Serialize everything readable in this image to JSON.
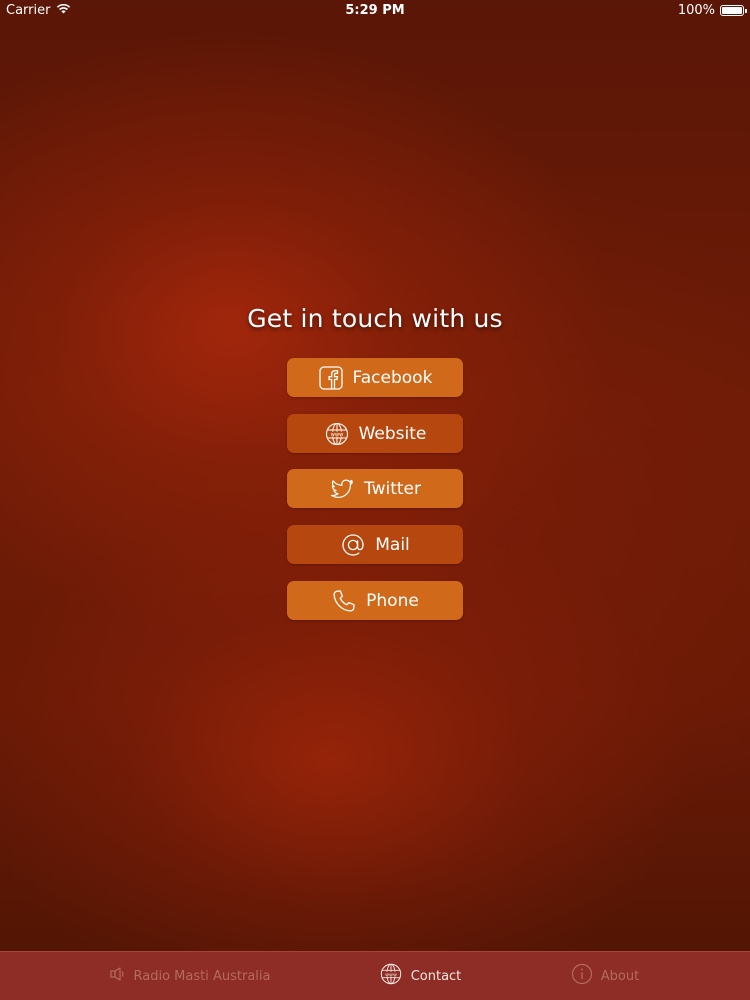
{
  "status_bar": {
    "carrier": "Carrier",
    "time": "5:29 PM",
    "battery": "100%"
  },
  "main": {
    "heading": "Get in touch with us",
    "buttons": [
      {
        "label": "Facebook",
        "icon": "facebook-icon"
      },
      {
        "label": "Website",
        "icon": "globe-www-icon"
      },
      {
        "label": "Twitter",
        "icon": "twitter-bird-icon"
      },
      {
        "label": "Mail",
        "icon": "at-sign-icon"
      },
      {
        "label": "Phone",
        "icon": "phone-icon"
      }
    ]
  },
  "tab_bar": {
    "tabs": [
      {
        "label": "Radio Masti Australia",
        "icon": "speaker-icon",
        "active": false
      },
      {
        "label": "Contact",
        "icon": "globe-www-icon",
        "active": true
      },
      {
        "label": "About",
        "icon": "info-icon",
        "active": false
      }
    ]
  },
  "colors": {
    "button_light": "#d06a1a",
    "button_dark": "#b6470f",
    "tab_bar_bg": "#8e2d25",
    "background": "#6a1a06"
  }
}
